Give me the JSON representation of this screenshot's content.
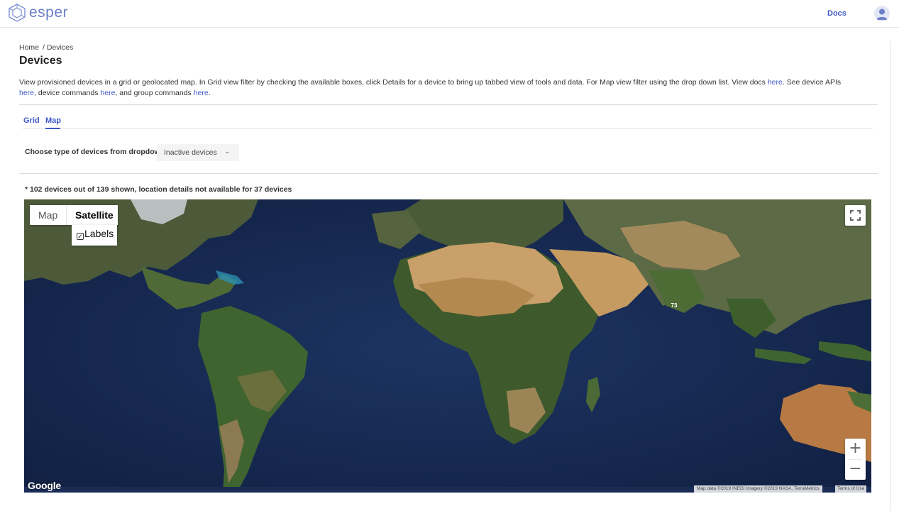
{
  "header": {
    "brand": "esper",
    "docs_label": "Docs"
  },
  "breadcrumb": {
    "home": "Home",
    "current": "/ Devices"
  },
  "page": {
    "title": "Devices",
    "description": {
      "part1": "View provisioned devices in a grid or geolocated map. In Grid view filter by checking the available boxes, click Details for a device to bring up tabbed view of tools and data. For Map view filter using the drop down list. View docs ",
      "link1": "here",
      "part2": ". See device APIs ",
      "link2": "here",
      "part3": ", device commands ",
      "link3": "here",
      "part4": ", and group commands ",
      "link4": "here",
      "part5": "."
    }
  },
  "tabs": {
    "grid": "Grid",
    "map": "Map",
    "active": "Map"
  },
  "filter": {
    "label": "Choose type of devices from dropdown",
    "selected": "Inactive devices"
  },
  "note": "* 102 devices out of 139 shown, location details not available for 37 devices",
  "map": {
    "type_map": "Map",
    "type_satellite": "Satellite",
    "active_type": "Satellite",
    "labels_label": "Labels",
    "labels_checked": true,
    "cluster_count": "73",
    "google_logo": "Google",
    "attribution": "Map data ©2019 INEGI Imagery ©2019 NASA, TerraMetrics",
    "terms": "Terms of Use",
    "icons": [
      "fullscreen-icon",
      "zoom-in-icon",
      "zoom-out-icon"
    ]
  },
  "colors": {
    "accent": "#3d57c9",
    "brand": "#6b7fc9",
    "ocean": "#13244a"
  }
}
